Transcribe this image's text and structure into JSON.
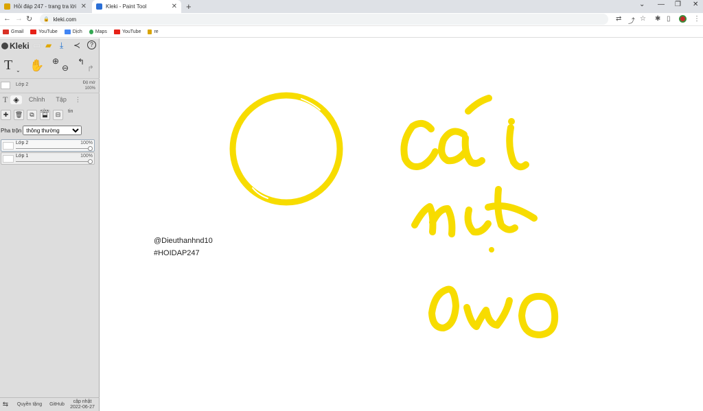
{
  "browser": {
    "tabs": [
      {
        "title": "Hỏi đáp 247 - trang tra lời",
        "active": false,
        "favicon_color": "#d9a400"
      },
      {
        "title": "Kleki - Paint Tool",
        "active": true,
        "favicon_color": "#2b6fd6"
      }
    ],
    "url": "kleki.com",
    "bookmarks": [
      {
        "label": "Gmail",
        "color": "#d93025"
      },
      {
        "label": "YouTube",
        "color": "#e62117"
      },
      {
        "label": "Dịch",
        "color": "#4285f4"
      },
      {
        "label": "Maps",
        "color": "#34a853"
      },
      {
        "label": "YouTube",
        "color": "#e62117"
      },
      {
        "label": "re",
        "color": "#d9a400"
      }
    ]
  },
  "kleki": {
    "logo": "Kleki",
    "active_layer": {
      "name": "Lớp 2",
      "opacity_label": "Độ mờ",
      "opacity": "100%"
    },
    "side_tabs": {
      "text_tab": "T",
      "adjust": "Chỉnh",
      "file": "Tập"
    },
    "layer_tools": {
      "edit_label": "sửa",
      "info_label": "tin"
    },
    "blend": {
      "label": "Pha trộn",
      "value": "thông thường"
    },
    "layers": [
      {
        "name": "Lớp 2",
        "opacity": "100%",
        "opacity_level": 1.0,
        "active": true
      },
      {
        "name": "Lớp 1",
        "opacity": "100%",
        "opacity_level": 1.0,
        "active": false
      }
    ],
    "footer": {
      "privacy": "Quyền tặng",
      "github": "GitHub",
      "update_label": "cập nhật",
      "update_date": "2022-06-27"
    }
  },
  "canvas": {
    "stroke_color": "#f7dc00",
    "credits": [
      "@Dieuthanhnd10",
      "#HOIDAP247"
    ]
  }
}
